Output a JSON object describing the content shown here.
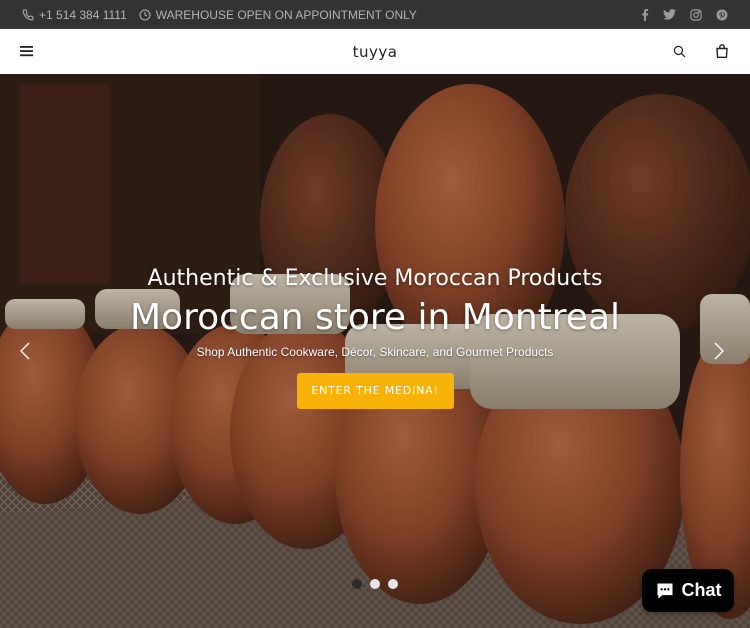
{
  "topbar": {
    "phone": "+1 514 384 1111",
    "hours": "WAREHOUSE OPEN ON APPOINTMENT ONLY",
    "socials": [
      "facebook-icon",
      "twitter-icon",
      "instagram-icon",
      "pinterest-icon"
    ]
  },
  "header": {
    "logo": "tuyya",
    "icons": [
      "hamburger-menu-icon",
      "search-icon",
      "shopping-bag-icon"
    ]
  },
  "hero": {
    "subtitle": "Authentic & Exclusive Moroccan Products",
    "title": "Moroccan store in Montreal",
    "tagline": "Shop Authentic Cookware, Décor, Skincare, and Gourmet Products",
    "cta": "ENTER THE MEDINA!",
    "slides_total": 3,
    "active_slide": 1
  },
  "chat": {
    "label": "Chat"
  },
  "colors": {
    "topbar_bg": "#333333",
    "cta_bg": "#f9b208",
    "chat_bg": "#000000"
  }
}
